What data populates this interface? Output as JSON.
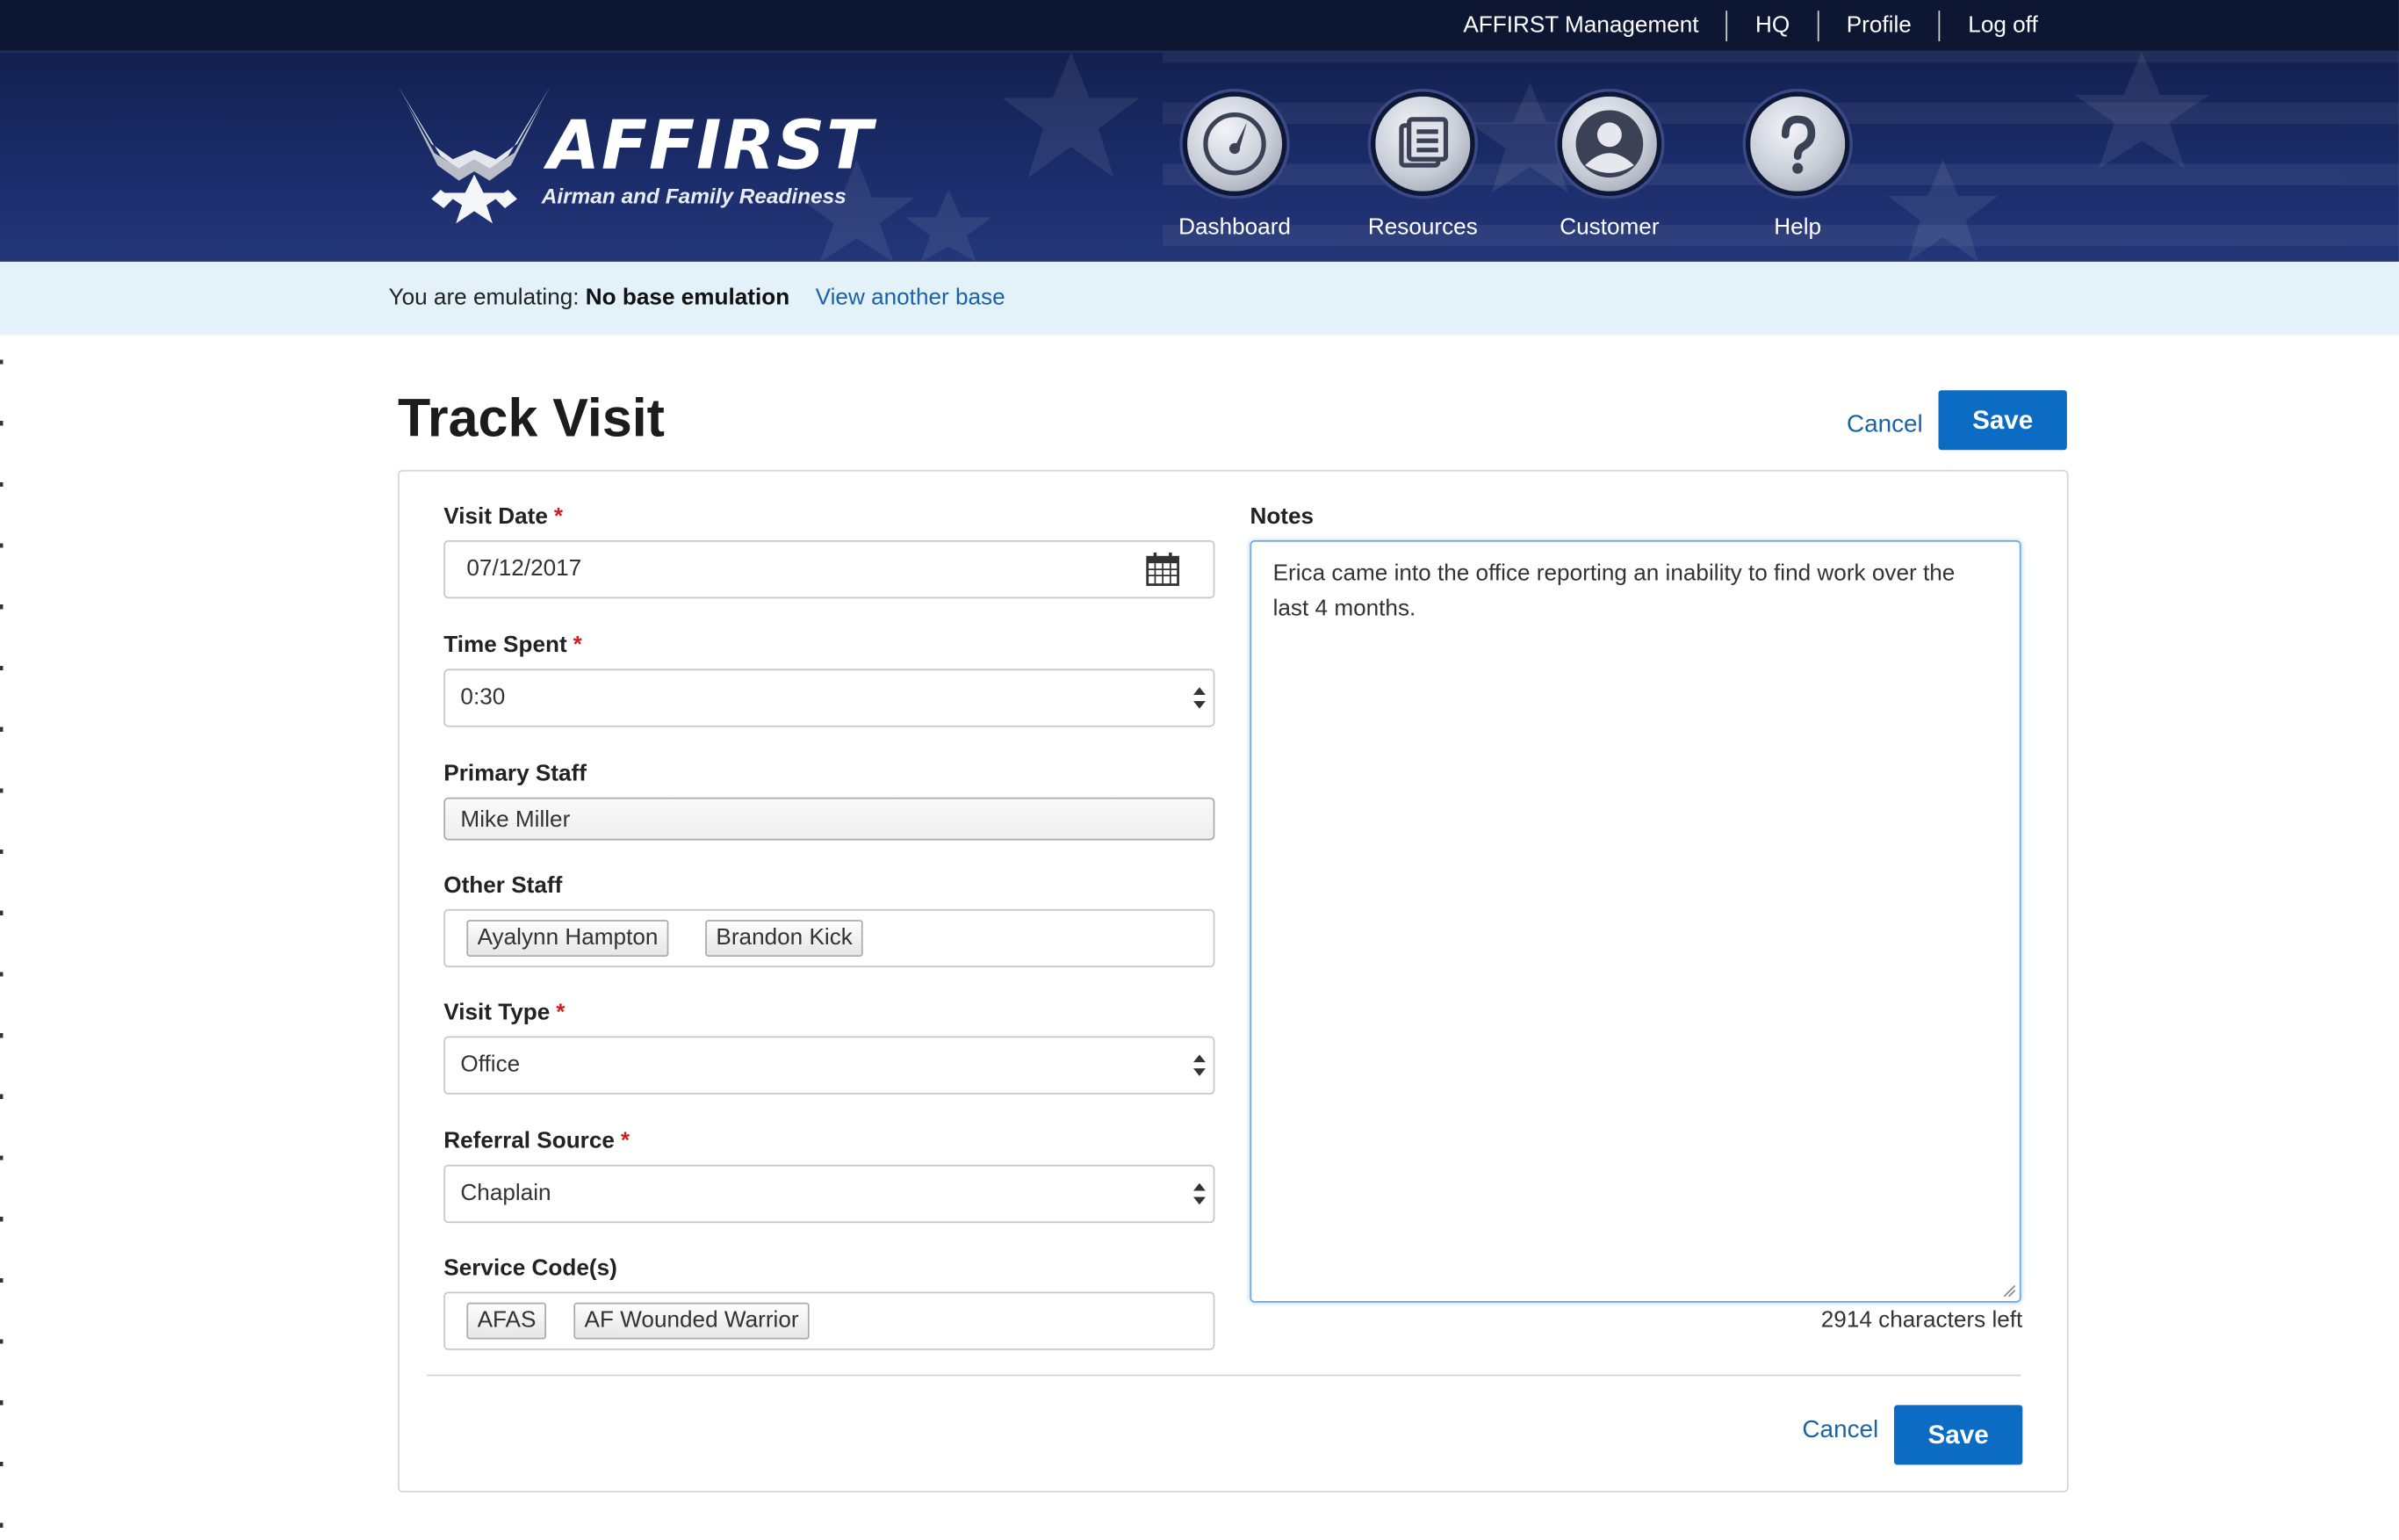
{
  "utility_nav": [
    "AFFIRST Management",
    "HQ",
    "Profile",
    "Log off"
  ],
  "brand": {
    "name": "AFFIRST",
    "tagline": "Airman and Family Readiness"
  },
  "main_nav": [
    {
      "label": "Dashboard",
      "icon": "gauge-icon"
    },
    {
      "label": "Resources",
      "icon": "documents-icon"
    },
    {
      "label": "Customer",
      "icon": "person-icon"
    },
    {
      "label": "Help",
      "icon": "question-icon"
    }
  ],
  "emulation": {
    "prefix": "You are emulating:",
    "value": "No base emulation",
    "link": "View another base"
  },
  "page": {
    "title": "Track Visit",
    "cancel": "Cancel",
    "save": "Save"
  },
  "form": {
    "visit_date": {
      "label": "Visit Date",
      "value": "07/12/2017"
    },
    "time_spent": {
      "label": "Time Spent",
      "value": "0:30"
    },
    "primary_staff": {
      "label": "Primary Staff",
      "value": "Mike Miller"
    },
    "other_staff": {
      "label": "Other Staff",
      "tags": [
        "Ayalynn Hampton",
        "Brandon Kick"
      ]
    },
    "visit_type": {
      "label": "Visit Type",
      "value": "Office"
    },
    "referral_source": {
      "label": "Referral Source",
      "value": "Chaplain"
    },
    "service_codes": {
      "label": "Service Code(s)",
      "tags": [
        "AFAS",
        "AF Wounded Warrior"
      ]
    },
    "notes": {
      "label": "Notes",
      "value": "Erica came into the office reporting an inability to find work over the last 4 months.",
      "chars_left": "2914 characters left"
    },
    "required_marker": "*"
  },
  "colors": {
    "navy": "#0d1633",
    "accent_blue": "#0c6cc4",
    "link_blue": "#1b63a8",
    "emulation_bg": "#e3f2f9",
    "required": "#cc1f1f"
  }
}
